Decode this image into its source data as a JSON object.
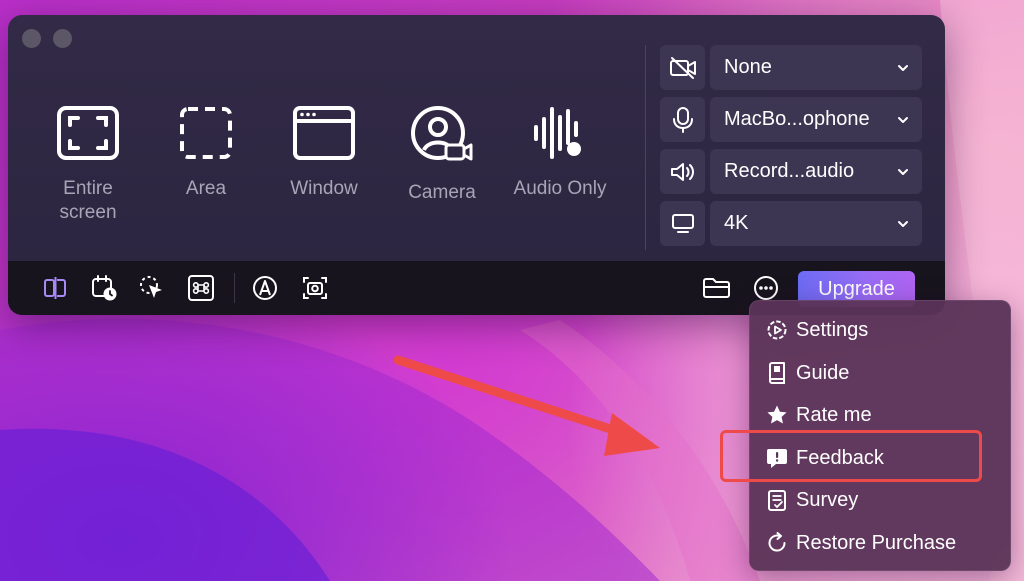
{
  "modes": [
    {
      "label": "Entire\nscreen",
      "icon": "entire-screen-icon"
    },
    {
      "label": "Area",
      "icon": "area-icon"
    },
    {
      "label": "Window",
      "icon": "window-icon"
    },
    {
      "label": "Camera",
      "icon": "camera-icon"
    },
    {
      "label": "Audio Only",
      "icon": "audio-wave-icon"
    }
  ],
  "mode_entire_line1": "Entire",
  "mode_entire_line2": "screen",
  "settings": {
    "camera": {
      "value": "None",
      "icon": "camera-off-icon"
    },
    "microphone": {
      "value": "MacBo...ophone",
      "icon": "microphone-icon"
    },
    "audio": {
      "value": "Record...audio",
      "icon": "speaker-icon"
    },
    "quality": {
      "value": "4K",
      "icon": "monitor-icon"
    }
  },
  "toolbar": {
    "upgrade_label": "Upgrade"
  },
  "menu": {
    "items": [
      {
        "label": "Settings",
        "icon": "gear-icon"
      },
      {
        "label": "Guide",
        "icon": "book-icon"
      },
      {
        "label": "Rate me",
        "icon": "star-icon"
      },
      {
        "label": "Feedback",
        "icon": "feedback-icon"
      },
      {
        "label": "Survey",
        "icon": "survey-icon"
      },
      {
        "label": "Restore Purchase",
        "icon": "restore-icon"
      }
    ]
  },
  "colors": {
    "window_bg": "#2f2843",
    "toolbar_bg": "#17141d",
    "accent_purple": "#8a6cf5",
    "highlight_red": "#ef4a4a",
    "menu_bg": "#5c3458"
  }
}
